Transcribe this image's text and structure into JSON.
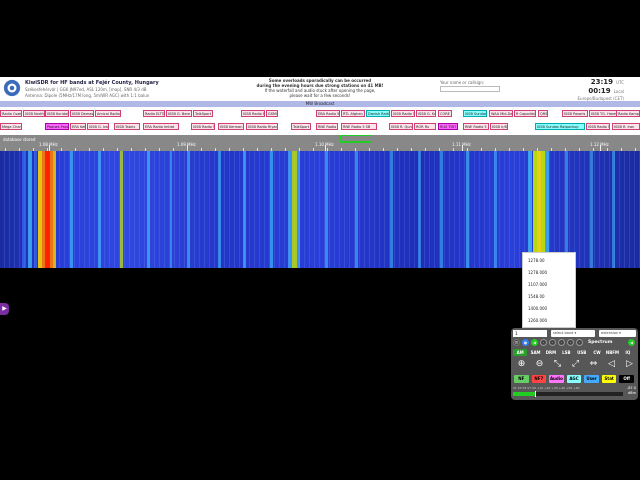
{
  "header": {
    "title": "KiwiSDR for HF bands at Fejér County, Hungary",
    "subtitle": "Székesfehérvár | GG6 JN97ed, ASL 120m, [map], SNR 4/3 dB",
    "antenna": "Antenna: Dipole (5MHz/17M long, 5m/WR AGC) with 1:1 balun",
    "notice_line1": "Some overloads sporadically can be occurred",
    "notice_line2": "during the evening hours due strong stations on 41 MB!",
    "notice_line3": "If the waterfall and audio stuck after opening the page,",
    "notice_line4": "please wait for a few seconds!",
    "search_label": "Your name or callsign:",
    "utc_time": "23:19",
    "utc_label": "UTC",
    "local_time": "00:19",
    "local_label": "Local",
    "timezone": "Europe/Budapest (CET)"
  },
  "band_bar": {
    "label": "MW Broadcast"
  },
  "dx_labels": [
    {
      "text": "Radio Csaky",
      "style": "pink"
    },
    {
      "text": "ISSB North",
      "style": "pink"
    },
    {
      "text": "ISSB Kuridal",
      "style": "pink"
    },
    {
      "text": "ISSB Demas",
      "style": "pink"
    },
    {
      "text": "Amical Radio",
      "style": "pink"
    },
    {
      "text": "Radio ELTTa",
      "style": "pink"
    },
    {
      "text": "ISSB G. Bere",
      "style": "pink"
    },
    {
      "text": "TalkSport",
      "style": "pink"
    },
    {
      "text": "ISSB Radio N",
      "style": "pink"
    },
    {
      "text": "GSMO",
      "style": "pink"
    },
    {
      "text": "EBA Radio 5",
      "style": "pink"
    },
    {
      "text": "RTL Afghan",
      "style": "pink"
    },
    {
      "text": "Danish Radio",
      "style": "cyan"
    },
    {
      "text": "ISSB Radio 5",
      "style": "pink"
    },
    {
      "text": "ISSB G. Kuwait",
      "style": "pink"
    },
    {
      "text": "CORE",
      "style": "pink"
    },
    {
      "text": "ISSB Sundas",
      "style": "cyan"
    },
    {
      "text": "WAA Mid-De",
      "style": "pink"
    },
    {
      "text": "R Capodistria",
      "style": "pink"
    },
    {
      "text": "QRS",
      "style": "pink"
    },
    {
      "text": "ISSB Pasaris",
      "style": "pink"
    },
    {
      "text": "ISSB TG. Hares",
      "style": "pink"
    },
    {
      "text": "Radio Kamp",
      "style": "pink"
    },
    {
      "text": "Mega Channel",
      "style": "pink"
    },
    {
      "text": "Paques Paxos",
      "style": "mag"
    },
    {
      "text": "ERA Ket",
      "style": "pink"
    },
    {
      "text": "ISSB G. Iran",
      "style": "pink"
    },
    {
      "text": "ISSB Tabriz",
      "style": "pink"
    },
    {
      "text": "ERA Radio Imtiat",
      "style": "pink"
    },
    {
      "text": "ISSB Radio 5",
      "style": "pink"
    },
    {
      "text": "ISSB Kerman",
      "style": "pink"
    },
    {
      "text": "ISSB Radio Riyadh",
      "style": "pink"
    },
    {
      "text": "TalkSport",
      "style": "pink"
    },
    {
      "text": "RNE Radio 5",
      "style": "pink"
    },
    {
      "text": "RNE Radio 5 SB",
      "style": "pink"
    },
    {
      "text": "ISSB R. Quran",
      "style": "pink"
    },
    {
      "text": "ROR Ru",
      "style": "pink"
    },
    {
      "text": "RUS TINT",
      "style": "mag"
    },
    {
      "text": "RNE Radio 5",
      "style": "pink"
    },
    {
      "text": "ISSB Ir/8",
      "style": "pink"
    },
    {
      "text": "ISSB Sundas Ratpackup",
      "style": "cyan"
    },
    {
      "text": "ISSB Radio 5",
      "style": "pink"
    },
    {
      "text": "ISSB R. Iran",
      "style": "pink"
    },
    {
      "text": "RNE Radio 5",
      "style": "pink"
    }
  ],
  "scale": {
    "tabs": "database  stored",
    "labels": [
      "1.08 MHz",
      "1.09 MHz",
      "1.10 MHz",
      "1.11 MHz",
      "1.12 MHz",
      "1.13 MHz"
    ]
  },
  "side_button": {
    "icon": "play-icon"
  },
  "freq_popup": {
    "items": [
      "1278.00",
      "1278.000",
      "1107.000",
      "1548.00",
      "1400.000",
      "1260.000"
    ]
  },
  "control_panel": {
    "freq_value": "1",
    "band_select": "select band",
    "ext_select": "extension",
    "spectrum_label": "Spectrum",
    "modes": [
      "AM",
      "SAM",
      "DRM",
      "LSB",
      "USB",
      "CW",
      "NBFM",
      "IQ"
    ],
    "active_mode": "AM",
    "buttons": [
      {
        "label": "NF",
        "color": "#6c6"
      },
      {
        "label": "NF7",
        "color": "#f44"
      },
      {
        "label": "Audio",
        "color": "#f7f"
      },
      {
        "label": "AGC",
        "color": "#8ff"
      },
      {
        "label": "User",
        "color": "#4af"
      },
      {
        "label": "Stat",
        "color": "#ff0"
      },
      {
        "label": "Off",
        "color": "#000"
      }
    ],
    "smeter_scale": "S1   S3   S5   S7   S9   +10  +20  +30  +40  +50  +60",
    "dbm_value": "-87.0",
    "dbm_unit": "dBm",
    "smeter_level": 0.2
  },
  "colors": {
    "accent": "#2c9c2c",
    "waterfall_base": "#2a3ed8",
    "signal_hot": "#ff2000",
    "signal_yellow": "#e8e800"
  }
}
